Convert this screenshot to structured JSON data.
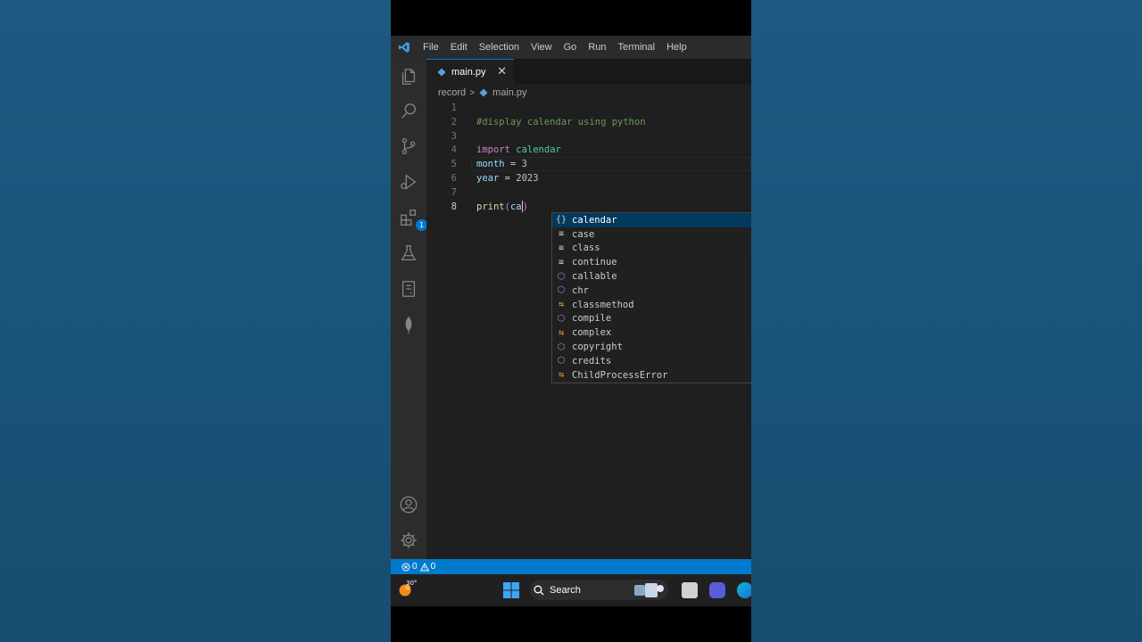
{
  "menu": {
    "items": [
      "File",
      "Edit",
      "Selection",
      "View",
      "Go",
      "Run",
      "Terminal",
      "Help"
    ]
  },
  "activity": {
    "extensions_badge": "1"
  },
  "tab": {
    "label": "main.py",
    "close": "✕"
  },
  "breadcrumb": {
    "folder": "record",
    "file": "main.py"
  },
  "code": {
    "line_numbers": [
      "1",
      "2",
      "3",
      "4",
      "5",
      "6",
      "7",
      "8"
    ],
    "comment": "#display calendar using python",
    "import_kw": "import",
    "import_mod": "calendar",
    "month_var": "month",
    "month_val": "3",
    "year_var": "year",
    "year_val": "2023",
    "print_fn": "print",
    "typed": "ca",
    "equals": " = ",
    "open_paren": "(",
    "close_paren": ")"
  },
  "suggestions": [
    {
      "label": "calendar",
      "kind": "module",
      "selected": true
    },
    {
      "label": "case",
      "kind": "keyword"
    },
    {
      "label": "class",
      "kind": "keyword"
    },
    {
      "label": "continue",
      "kind": "keyword"
    },
    {
      "label": "callable",
      "kind": "function"
    },
    {
      "label": "chr",
      "kind": "function"
    },
    {
      "label": "classmethod",
      "kind": "class"
    },
    {
      "label": "compile",
      "kind": "function"
    },
    {
      "label": "complex",
      "kind": "class"
    },
    {
      "label": "copyright",
      "kind": "variable"
    },
    {
      "label": "credits",
      "kind": "variable"
    },
    {
      "label": "ChildProcessError",
      "kind": "class"
    }
  ],
  "status": {
    "errors": "0",
    "warnings": "0"
  },
  "taskbar": {
    "temperature": "30°",
    "search_label": "Search"
  },
  "colors": {
    "accent": "#0078d4",
    "statusbar": "#007acc"
  }
}
